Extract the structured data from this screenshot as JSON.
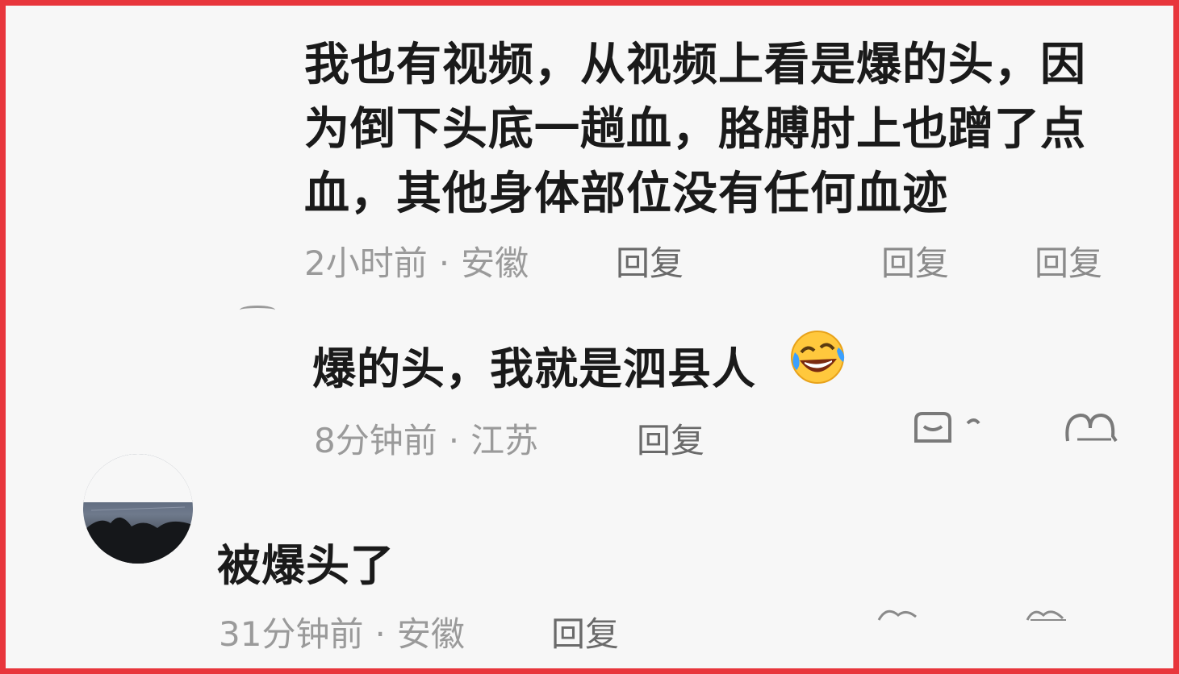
{
  "comments": [
    {
      "lines": [
        "我也有视频，从视频上看是爆的头，因",
        "为倒下头底一趟血，胳膊肘上也蹭了点",
        "血，其他身体部位没有任何血迹"
      ],
      "time": "2小时前",
      "location": "安徽",
      "reply_label": "回复",
      "action_1": "回复",
      "action_2": "回复"
    },
    {
      "text": "爆的头，我就是泗县人",
      "emoji_icon": "rofl-emoji-icon",
      "time": "8分钟前",
      "location": "江苏",
      "reply_label": "回复"
    },
    {
      "text": "被爆头了",
      "time": "31分钟前",
      "location": "安徽",
      "reply_label": "回复"
    }
  ],
  "separator": "·",
  "colors": {
    "border": "#e8363c",
    "text": "#1a1a1a",
    "meta": "#9a9a9a"
  }
}
